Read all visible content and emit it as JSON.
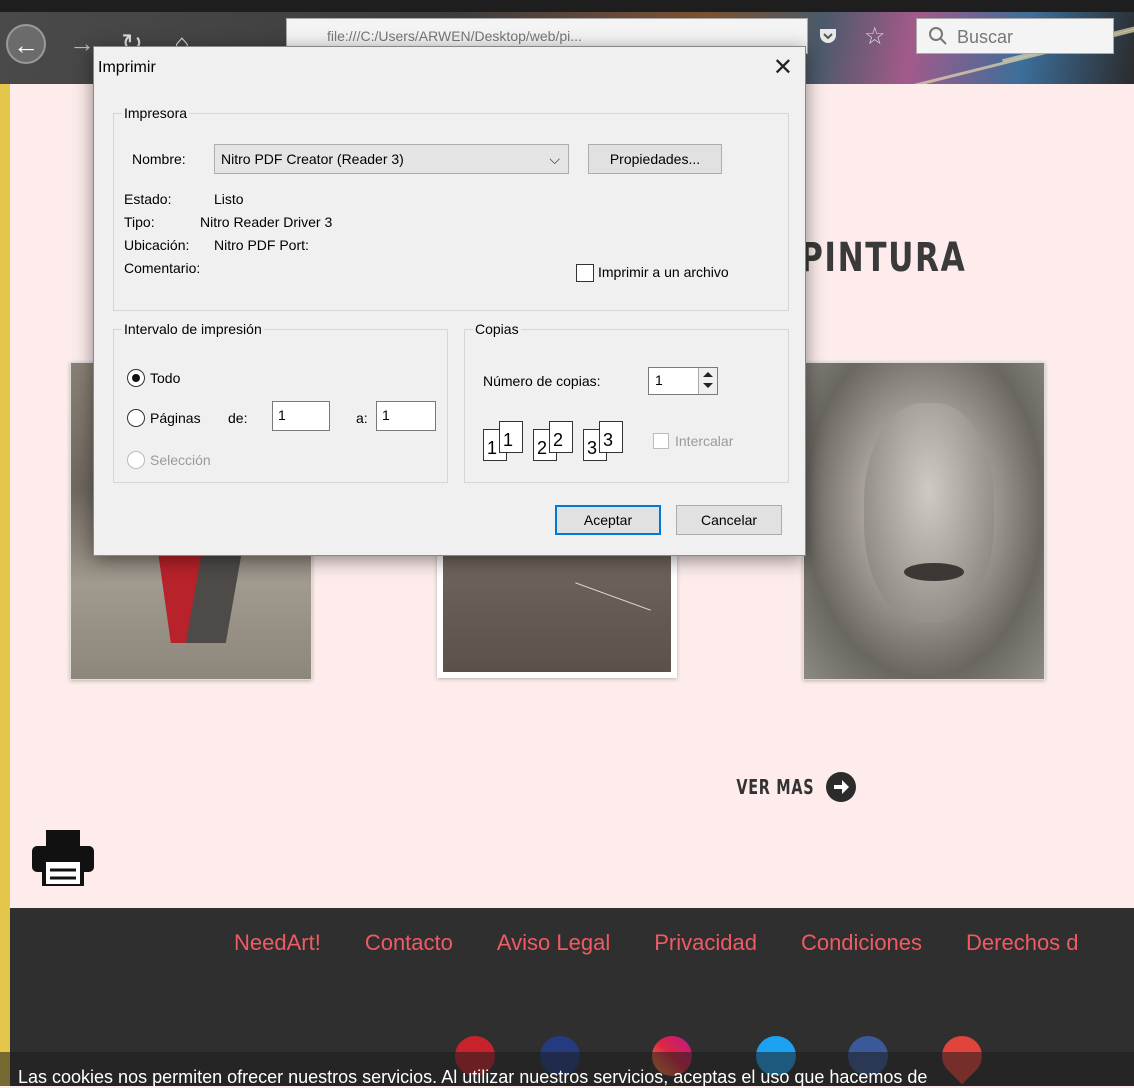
{
  "browser": {
    "url": "file:///C:/Users/ARWEN/Desktop/web/pi...",
    "search_placeholder": "Buscar"
  },
  "page": {
    "section_title": "PINTURA",
    "ver_mas": "VER MAS",
    "footer_links": [
      "NeedArt!",
      "Contacto",
      "Aviso Legal",
      "Privacidad",
      "Condiciones",
      "Derechos d"
    ],
    "cookie_text": "Las cookies nos permiten ofrecer nuestros servicios. Al utilizar nuestros servicios, aceptas el uso que hacemos de"
  },
  "dialog": {
    "title": "Imprimir",
    "printer": {
      "legend": "Impresora",
      "name_label": "Nombre:",
      "name_value": "Nitro PDF Creator (Reader 3)",
      "properties_label": "Propiedades...",
      "status_label": "Estado:",
      "status_value": "Listo",
      "type_label": "Tipo:",
      "type_value": "Nitro Reader Driver 3",
      "location_label": "Ubicación:",
      "location_value": "Nitro PDF Port:",
      "comment_label": "Comentario:",
      "print_to_file_label": "Imprimir a un archivo"
    },
    "range": {
      "legend": "Intervalo de impresión",
      "all_label": "Todo",
      "pages_label": "Páginas",
      "from_label": "de:",
      "from_value": "1",
      "to_label": "a:",
      "to_value": "1",
      "selection_label": "Selección"
    },
    "copies": {
      "legend": "Copias",
      "count_label": "Número de copias:",
      "count_value": "1",
      "collate_pages": [
        "1",
        "1",
        "2",
        "2",
        "3",
        "3"
      ],
      "collate_label": "Intercalar"
    },
    "ok_label": "Aceptar",
    "cancel_label": "Cancelar"
  }
}
